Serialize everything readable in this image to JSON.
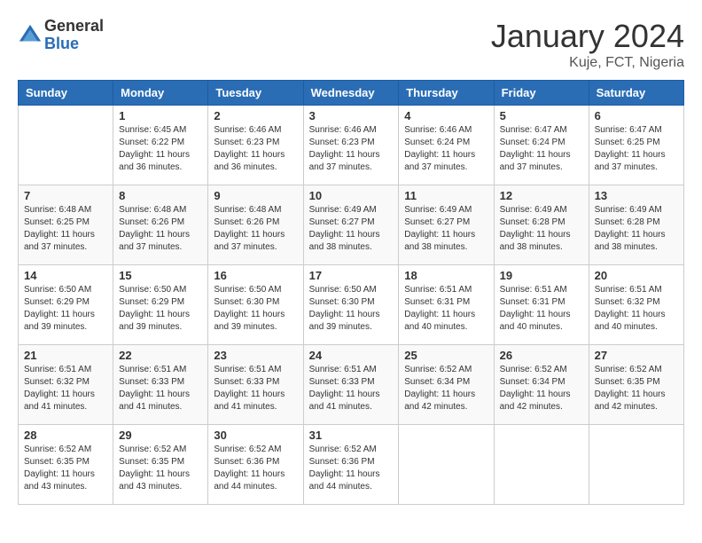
{
  "header": {
    "logo": {
      "general": "General",
      "blue": "Blue"
    },
    "title": "January 2024",
    "location": "Kuje, FCT, Nigeria"
  },
  "calendar": {
    "weekdays": [
      "Sunday",
      "Monday",
      "Tuesday",
      "Wednesday",
      "Thursday",
      "Friday",
      "Saturday"
    ],
    "weeks": [
      [
        {
          "day": "",
          "info": ""
        },
        {
          "day": "1",
          "info": "Sunrise: 6:45 AM\nSunset: 6:22 PM\nDaylight: 11 hours\nand 36 minutes."
        },
        {
          "day": "2",
          "info": "Sunrise: 6:46 AM\nSunset: 6:23 PM\nDaylight: 11 hours\nand 36 minutes."
        },
        {
          "day": "3",
          "info": "Sunrise: 6:46 AM\nSunset: 6:23 PM\nDaylight: 11 hours\nand 37 minutes."
        },
        {
          "day": "4",
          "info": "Sunrise: 6:46 AM\nSunset: 6:24 PM\nDaylight: 11 hours\nand 37 minutes."
        },
        {
          "day": "5",
          "info": "Sunrise: 6:47 AM\nSunset: 6:24 PM\nDaylight: 11 hours\nand 37 minutes."
        },
        {
          "day": "6",
          "info": "Sunrise: 6:47 AM\nSunset: 6:25 PM\nDaylight: 11 hours\nand 37 minutes."
        }
      ],
      [
        {
          "day": "7",
          "info": "Sunrise: 6:48 AM\nSunset: 6:25 PM\nDaylight: 11 hours\nand 37 minutes."
        },
        {
          "day": "8",
          "info": "Sunrise: 6:48 AM\nSunset: 6:26 PM\nDaylight: 11 hours\nand 37 minutes."
        },
        {
          "day": "9",
          "info": "Sunrise: 6:48 AM\nSunset: 6:26 PM\nDaylight: 11 hours\nand 37 minutes."
        },
        {
          "day": "10",
          "info": "Sunrise: 6:49 AM\nSunset: 6:27 PM\nDaylight: 11 hours\nand 38 minutes."
        },
        {
          "day": "11",
          "info": "Sunrise: 6:49 AM\nSunset: 6:27 PM\nDaylight: 11 hours\nand 38 minutes."
        },
        {
          "day": "12",
          "info": "Sunrise: 6:49 AM\nSunset: 6:28 PM\nDaylight: 11 hours\nand 38 minutes."
        },
        {
          "day": "13",
          "info": "Sunrise: 6:49 AM\nSunset: 6:28 PM\nDaylight: 11 hours\nand 38 minutes."
        }
      ],
      [
        {
          "day": "14",
          "info": "Sunrise: 6:50 AM\nSunset: 6:29 PM\nDaylight: 11 hours\nand 39 minutes."
        },
        {
          "day": "15",
          "info": "Sunrise: 6:50 AM\nSunset: 6:29 PM\nDaylight: 11 hours\nand 39 minutes."
        },
        {
          "day": "16",
          "info": "Sunrise: 6:50 AM\nSunset: 6:30 PM\nDaylight: 11 hours\nand 39 minutes."
        },
        {
          "day": "17",
          "info": "Sunrise: 6:50 AM\nSunset: 6:30 PM\nDaylight: 11 hours\nand 39 minutes."
        },
        {
          "day": "18",
          "info": "Sunrise: 6:51 AM\nSunset: 6:31 PM\nDaylight: 11 hours\nand 40 minutes."
        },
        {
          "day": "19",
          "info": "Sunrise: 6:51 AM\nSunset: 6:31 PM\nDaylight: 11 hours\nand 40 minutes."
        },
        {
          "day": "20",
          "info": "Sunrise: 6:51 AM\nSunset: 6:32 PM\nDaylight: 11 hours\nand 40 minutes."
        }
      ],
      [
        {
          "day": "21",
          "info": "Sunrise: 6:51 AM\nSunset: 6:32 PM\nDaylight: 11 hours\nand 41 minutes."
        },
        {
          "day": "22",
          "info": "Sunrise: 6:51 AM\nSunset: 6:33 PM\nDaylight: 11 hours\nand 41 minutes."
        },
        {
          "day": "23",
          "info": "Sunrise: 6:51 AM\nSunset: 6:33 PM\nDaylight: 11 hours\nand 41 minutes."
        },
        {
          "day": "24",
          "info": "Sunrise: 6:51 AM\nSunset: 6:33 PM\nDaylight: 11 hours\nand 41 minutes."
        },
        {
          "day": "25",
          "info": "Sunrise: 6:52 AM\nSunset: 6:34 PM\nDaylight: 11 hours\nand 42 minutes."
        },
        {
          "day": "26",
          "info": "Sunrise: 6:52 AM\nSunset: 6:34 PM\nDaylight: 11 hours\nand 42 minutes."
        },
        {
          "day": "27",
          "info": "Sunrise: 6:52 AM\nSunset: 6:35 PM\nDaylight: 11 hours\nand 42 minutes."
        }
      ],
      [
        {
          "day": "28",
          "info": "Sunrise: 6:52 AM\nSunset: 6:35 PM\nDaylight: 11 hours\nand 43 minutes."
        },
        {
          "day": "29",
          "info": "Sunrise: 6:52 AM\nSunset: 6:35 PM\nDaylight: 11 hours\nand 43 minutes."
        },
        {
          "day": "30",
          "info": "Sunrise: 6:52 AM\nSunset: 6:36 PM\nDaylight: 11 hours\nand 44 minutes."
        },
        {
          "day": "31",
          "info": "Sunrise: 6:52 AM\nSunset: 6:36 PM\nDaylight: 11 hours\nand 44 minutes."
        },
        {
          "day": "",
          "info": ""
        },
        {
          "day": "",
          "info": ""
        },
        {
          "day": "",
          "info": ""
        }
      ]
    ]
  }
}
